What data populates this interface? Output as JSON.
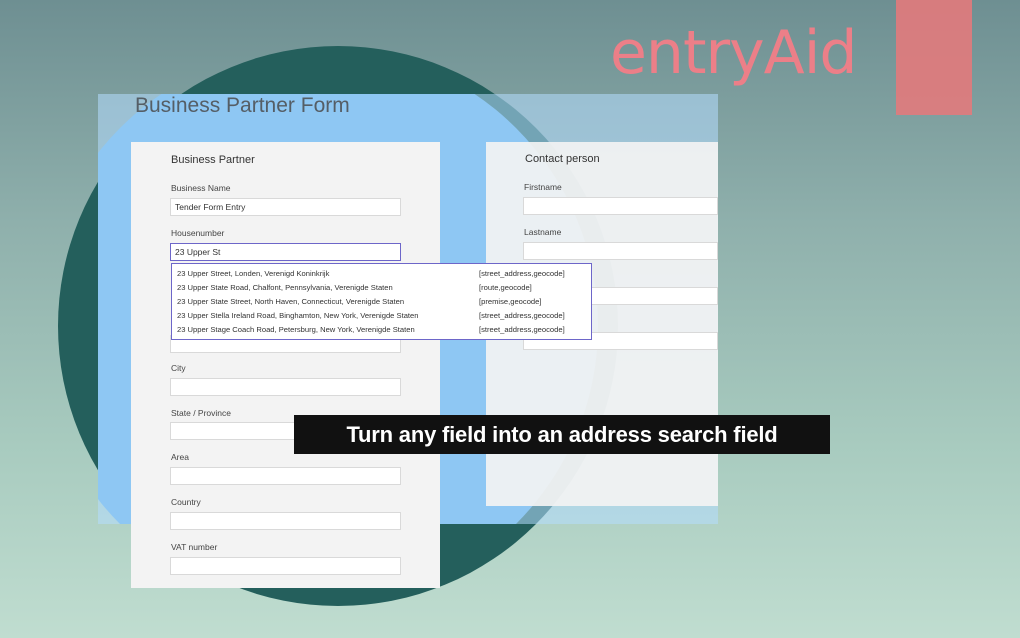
{
  "brand": {
    "name": "entryAid",
    "accent": "#e27a7c"
  },
  "form": {
    "title": "Business Partner Form",
    "business_partner": {
      "heading": "Business Partner",
      "business_name_label": "Business Name",
      "business_name_value": "Tender Form Entry",
      "housenumber_label": "Housenumber",
      "housenumber_value": "23 Upper St",
      "city_label": "City",
      "state_label": "State / Province",
      "area_label": "Area",
      "country_label": "Country",
      "vat_label": "VAT number"
    },
    "suggestions": [
      {
        "address": "23 Upper Street, Londen, Verenigd Koninkrijk",
        "type": "[street_address,geocode]"
      },
      {
        "address": "23 Upper State Road, Chalfont, Pennsylvania, Verenigde Staten",
        "type": "[route,geocode]"
      },
      {
        "address": "23 Upper State Street, North Haven, Connecticut, Verenigde Staten",
        "type": "[premise,geocode]"
      },
      {
        "address": "23 Upper Stella Ireland Road, Binghamton, New York, Verenigde Staten",
        "type": "[street_address,geocode]"
      },
      {
        "address": "23 Upper Stage Coach Road, Petersburg, New York, Verenigde Staten",
        "type": "[street_address,geocode]"
      }
    ],
    "contact_person": {
      "heading": "Contact person",
      "firstname_label": "Firstname",
      "lastname_label": "Lastname"
    }
  },
  "caption": "Turn any field into an address search field"
}
